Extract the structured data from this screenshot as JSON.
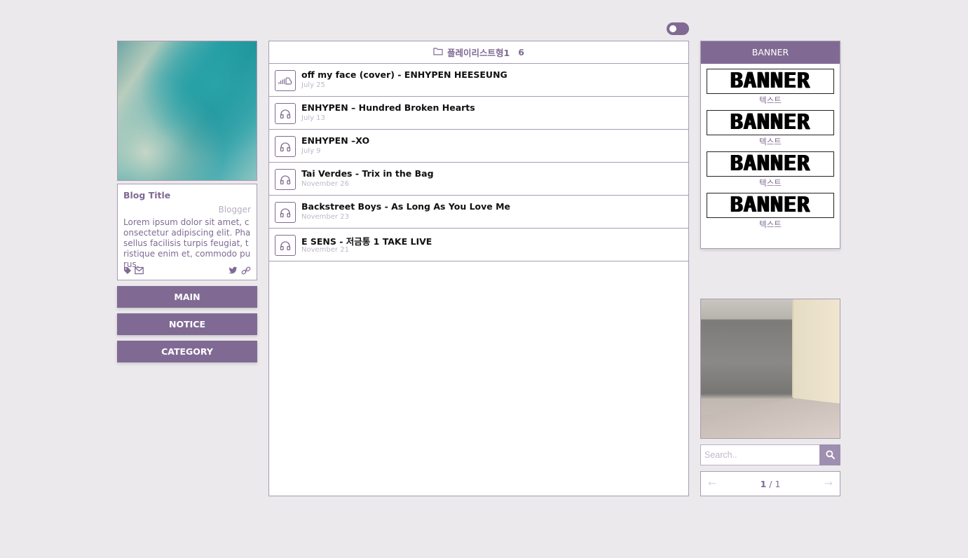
{
  "colors": {
    "accent": "#806a94",
    "background": "#ebe9ec",
    "muted": "#c2b7cd"
  },
  "profile": {
    "blog_title": "Blog Title",
    "blogger": "Blogger",
    "description": "Lorem ipsum dolor sit amet, consectetur adipiscing elit. Phasellus facilisis turpis feugiat, tristique enim et, commodo purus.",
    "icons": [
      "tag-icon",
      "mail-icon",
      "twitter-icon",
      "link-icon"
    ]
  },
  "nav": {
    "main": "MAIN",
    "notice": "NOTICE",
    "category": "CATEGORY"
  },
  "playlist": {
    "title": "플레이리스트형1",
    "count": "6",
    "items": [
      {
        "title": "off my face (cover) - ENHYPEN HEESEUNG",
        "date": "July 25",
        "icon": "soundcloud-icon"
      },
      {
        "title": "ENHYPEN – Hundred Broken Hearts",
        "date": "July 13",
        "icon": "headphones-icon"
      },
      {
        "title": "ENHYPEN –XO",
        "date": "July 9",
        "icon": "headphones-icon"
      },
      {
        "title": "Tai Verdes - Trix in the Bag",
        "date": "November 26",
        "icon": "headphones-icon"
      },
      {
        "title": "Backstreet Boys - As Long As You Love Me",
        "date": "November 23",
        "icon": "headphones-icon"
      },
      {
        "title": "E SENS - 저금통 1 TAKE LIVE",
        "date": "November 21",
        "icon": "headphones-icon"
      }
    ]
  },
  "banner": {
    "header": "BANNER",
    "items": [
      {
        "image_text": "BANNER",
        "caption": "텍스트"
      },
      {
        "image_text": "BANNER",
        "caption": "텍스트"
      },
      {
        "image_text": "BANNER",
        "caption": "텍스트"
      },
      {
        "image_text": "BANNER",
        "caption": "텍스트"
      }
    ]
  },
  "search": {
    "placeholder": "Search.."
  },
  "pager": {
    "current": "1",
    "separator": "/",
    "total": "1",
    "prev": "←",
    "next": "→"
  }
}
